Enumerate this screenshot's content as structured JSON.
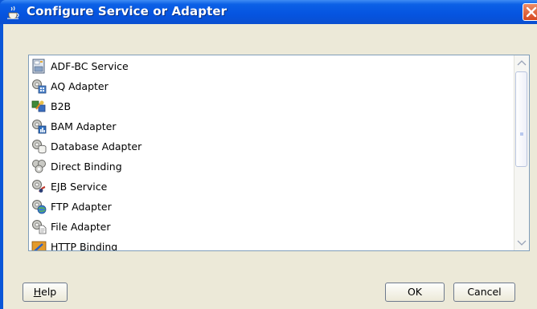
{
  "window": {
    "title": "Configure Service or Adapter",
    "title_bar_color": "#0554e0",
    "close_button_color": "#d64820"
  },
  "list": {
    "items": [
      {
        "label": "ADF-BC Service",
        "icon": "adf-bc-service-icon"
      },
      {
        "label": "AQ Adapter",
        "icon": "aq-adapter-icon"
      },
      {
        "label": "B2B",
        "icon": "b2b-icon"
      },
      {
        "label": "BAM Adapter",
        "icon": "bam-adapter-icon"
      },
      {
        "label": "Database Adapter",
        "icon": "database-adapter-icon"
      },
      {
        "label": "Direct Binding",
        "icon": "direct-binding-icon"
      },
      {
        "label": "EJB Service",
        "icon": "ejb-service-icon"
      },
      {
        "label": "FTP Adapter",
        "icon": "ftp-adapter-icon"
      },
      {
        "label": "File Adapter",
        "icon": "file-adapter-icon"
      },
      {
        "label": "HTTP Binding",
        "icon": "http-binding-icon"
      }
    ]
  },
  "buttons": {
    "help": {
      "prefix": "",
      "mnemonic": "H",
      "rest": "elp"
    },
    "ok": "OK",
    "cancel": "Cancel"
  }
}
